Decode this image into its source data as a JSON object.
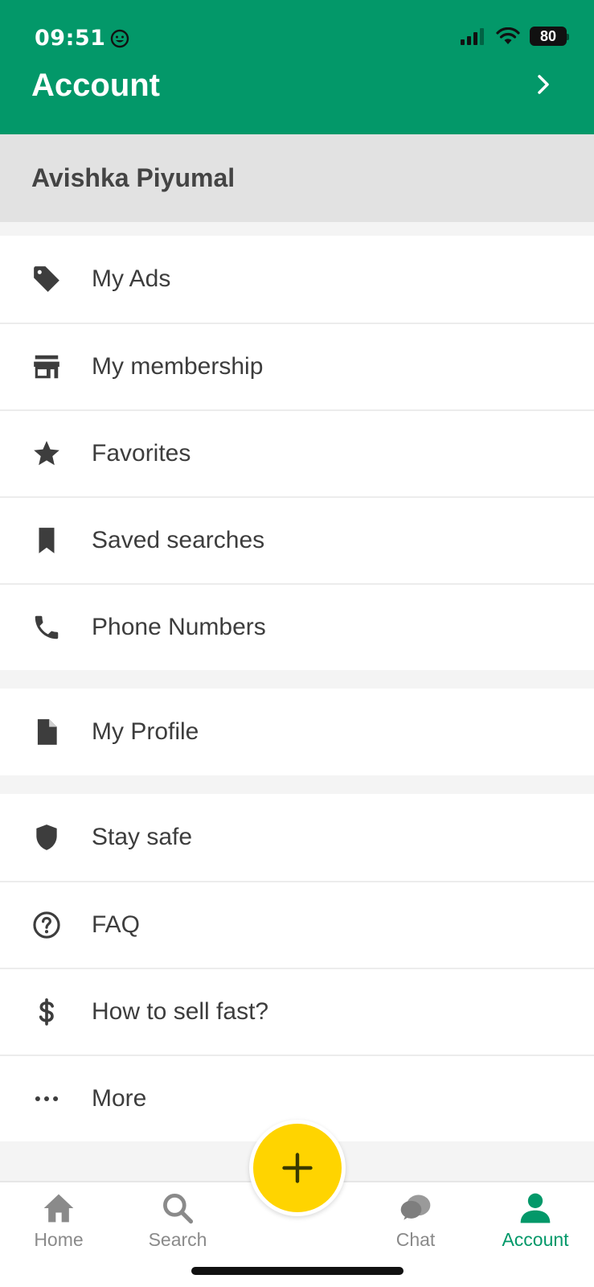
{
  "status": {
    "time": "09:51",
    "battery": "80"
  },
  "header": {
    "title": "Account"
  },
  "user": {
    "name": "Avishka Piyumal"
  },
  "menu": {
    "group1": [
      {
        "label": "My Ads",
        "icon": "tag-icon"
      },
      {
        "label": "My membership",
        "icon": "store-icon"
      },
      {
        "label": "Favorites",
        "icon": "star-icon"
      },
      {
        "label": "Saved searches",
        "icon": "bookmark-icon"
      },
      {
        "label": "Phone Numbers",
        "icon": "phone-icon"
      }
    ],
    "group2": [
      {
        "label": "My Profile",
        "icon": "document-icon"
      }
    ],
    "group3": [
      {
        "label": "Stay safe",
        "icon": "shield-icon"
      },
      {
        "label": "FAQ",
        "icon": "help-circle-icon"
      },
      {
        "label": "How to sell fast?",
        "icon": "dollar-icon"
      },
      {
        "label": "More",
        "icon": "more-dots-icon"
      }
    ]
  },
  "tabs": [
    {
      "label": "Home",
      "icon": "home-icon",
      "active": false
    },
    {
      "label": "Search",
      "icon": "search-icon",
      "active": false
    },
    {
      "label": "Chat",
      "icon": "chat-icon",
      "active": false
    },
    {
      "label": "Account",
      "icon": "person-icon",
      "active": true
    }
  ],
  "fab": {
    "icon": "plus-icon"
  },
  "colors": {
    "brand": "#039869",
    "fab": "#ffd400",
    "icon": "#3d3d3d",
    "tab_inactive": "#8a8a8a"
  }
}
